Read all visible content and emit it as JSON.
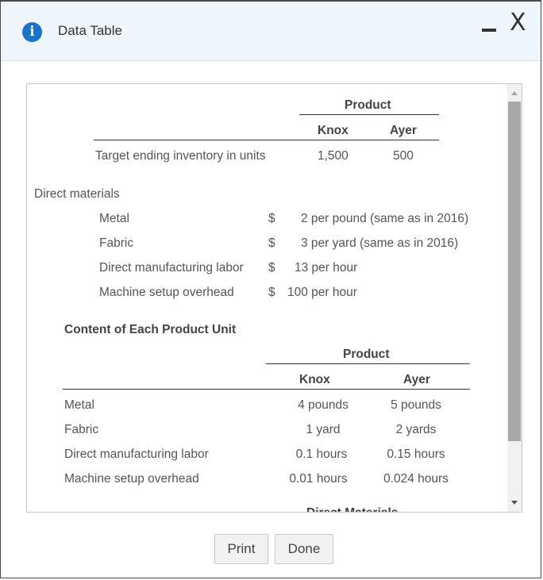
{
  "dialog": {
    "title": "Data Table",
    "icons": {
      "info": "info-icon",
      "minimize": "minimize-icon",
      "close": "close-icon"
    },
    "info_glyph": "i",
    "close_glyph": "X"
  },
  "table1": {
    "header": "Product",
    "cols": [
      "Knox",
      "Ayer"
    ],
    "row": {
      "label": "Target ending inventory in units",
      "knox": "1,500",
      "ayer": "500"
    }
  },
  "direct_materials": {
    "heading": "Direct materials",
    "rows": [
      {
        "label": "Metal",
        "currency": "$",
        "value": "2 per pound (same as in 2016)"
      },
      {
        "label": "Fabric",
        "currency": "$",
        "value": "3 per yard (same as in 2016)"
      },
      {
        "label": "Direct manufacturing labor",
        "currency": "$",
        "value": "13 per hour"
      },
      {
        "label": "Machine setup overhead",
        "currency": "$",
        "value": "100 per hour"
      }
    ]
  },
  "table2": {
    "heading": "Content of Each Product Unit",
    "header": "Product",
    "cols": [
      "Knox",
      "Ayer"
    ],
    "rows": [
      {
        "label": "Metal",
        "knox": "4 pounds",
        "ayer": "5 pounds"
      },
      {
        "label": "Fabric",
        "knox": "1 yard",
        "ayer": "2 yards"
      },
      {
        "label": "Direct manufacturing labor",
        "knox": "0.1 hours",
        "ayer": "0.15 hours"
      },
      {
        "label": "Machine setup overhead",
        "knox": "0.01 hours",
        "ayer": "0.024 hours"
      }
    ],
    "cut_off_heading": "Direct Materials"
  },
  "buttons": {
    "print": "Print",
    "done": "Done"
  }
}
